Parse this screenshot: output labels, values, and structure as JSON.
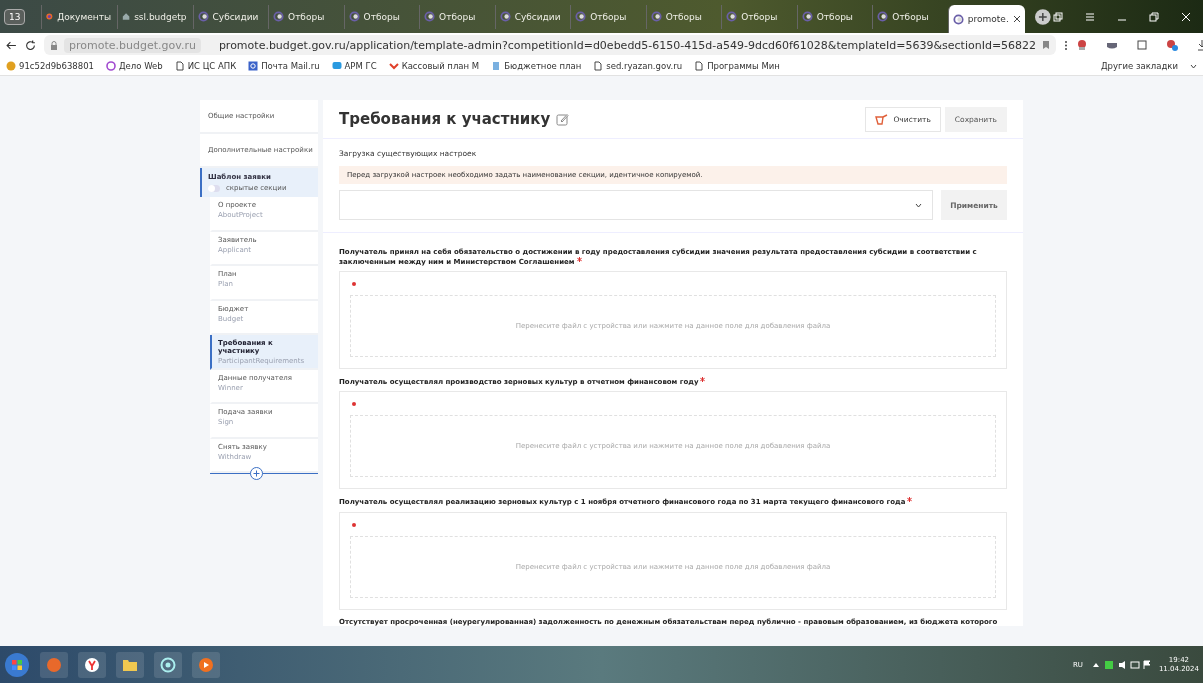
{
  "browser": {
    "tab_count": "13",
    "tabs": [
      {
        "label": "Документы",
        "kind": "fox",
        "selected": false
      },
      {
        "label": "ssl.budgetp",
        "kind": "house",
        "selected": false
      },
      {
        "label": "Субсидии",
        "kind": "ring",
        "selected": false
      },
      {
        "label": "Отборы",
        "kind": "ring",
        "selected": false
      },
      {
        "label": "Отборы",
        "kind": "ring",
        "selected": false
      },
      {
        "label": "Отборы",
        "kind": "ring",
        "selected": false
      },
      {
        "label": "Субсидии",
        "kind": "ring",
        "selected": false
      },
      {
        "label": "Отборы",
        "kind": "ring",
        "selected": false
      },
      {
        "label": "Отборы",
        "kind": "ring",
        "selected": false
      },
      {
        "label": "Отборы",
        "kind": "ring",
        "selected": false
      },
      {
        "label": "Отборы",
        "kind": "ring",
        "selected": false
      },
      {
        "label": "Отборы",
        "kind": "ring",
        "selected": false
      },
      {
        "label": "promote.",
        "kind": "ring",
        "selected": true
      }
    ],
    "site_chip": "promote.budget.gov.ru",
    "url": "promote.budget.gov.ru/application/template-admin?competitionId=d0ebedd5-6150-415d-a549-9dcd60f61028&templateId=5639&sectionId=56822",
    "bookmarks": [
      {
        "label": "91c52d9b638801",
        "kind": "coin"
      },
      {
        "label": "Дело Web",
        "kind": "swirl"
      },
      {
        "label": "ИС ЦС АПК",
        "kind": "page"
      },
      {
        "label": "Почта Mail.ru",
        "kind": "mail"
      },
      {
        "label": "АРМ ГС",
        "kind": "chat"
      },
      {
        "label": "Кассовый план М",
        "kind": "mark"
      },
      {
        "label": "Бюджетное план",
        "kind": "doc"
      },
      {
        "label": "sed.ryazan.gov.ru",
        "kind": "page"
      },
      {
        "label": "Программы Мин",
        "kind": "page"
      }
    ],
    "other_bookmarks": "Другие закладки"
  },
  "sidebar": {
    "top_items": [
      {
        "label": "Общие настройки"
      },
      {
        "label": "Дополнительные настройки"
      }
    ],
    "template": {
      "label": "Шаблон заявки",
      "hidden_sections_label": "скрытые секции",
      "hidden_sections_on": false
    },
    "sections": [
      {
        "label": "О проекте",
        "code": "AboutProject",
        "selected": false
      },
      {
        "label": "Заявитель",
        "code": "Applicant",
        "selected": false
      },
      {
        "label": "План",
        "code": "Plan",
        "selected": false
      },
      {
        "label": "Бюджет",
        "code": "Budget",
        "selected": false
      },
      {
        "label": "Требования к участнику",
        "code": "ParticipantRequirements",
        "selected": true
      },
      {
        "label": "Данные получателя",
        "code": "Winner",
        "selected": false
      },
      {
        "label": "Подача заявки",
        "code": "Sign",
        "selected": false
      },
      {
        "label": "Снять заявку",
        "code": "Withdraw",
        "selected": false
      }
    ]
  },
  "main": {
    "title": "Требования к участнику",
    "clear_button": "Очистить",
    "save_button": "Сохранить",
    "load_settings": {
      "label": "Загрузка существующих настроек",
      "warning": "Перед загрузкой настроек необходимо задать наименование секции, идентичное копируемой.",
      "apply_button": "Применить"
    },
    "questions": [
      {
        "text": "Получатель принял на себя обязательство о достижении в году предоставления субсидии значения результата предоставления субсидии в соответствии с заключенным между ним и Министерством Соглашением",
        "required": true,
        "dropzone": "Перенесите файл с устройства или нажмите на данное поле для добавления файла"
      },
      {
        "text": "Получатель осуществлял производство зерновых культур в отчетном финансовом году",
        "required": true,
        "dropzone": "Перенесите файл с устройства или нажмите на данное поле для добавления файла"
      },
      {
        "text": "Получатель осуществлял реализацию зерновых культур с 1 ноября отчетного финансового года по 31 марта текущего финансового года",
        "required": true,
        "dropzone": "Перенесите файл с устройства или нажмите на данное поле для добавления файла"
      }
    ],
    "partial_question": "Отсутствует просроченная (неурегулированная) задолженность по денежным обязательствам перед публично - правовым образованием, из бюджета которого"
  },
  "taskbar": {
    "language": "RU",
    "time": "19:42",
    "date": "11.04.2024"
  }
}
